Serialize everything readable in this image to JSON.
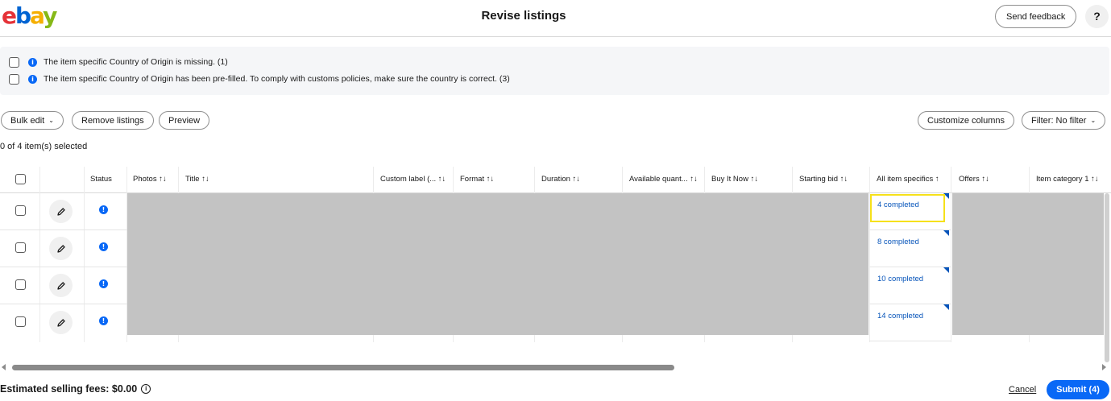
{
  "header": {
    "logo_letters": [
      "e",
      "b",
      "a",
      "y"
    ],
    "title": "Revise listings",
    "feedback_label": "Send feedback",
    "help_label": "?"
  },
  "notices": [
    {
      "text": "The item specific Country of Origin is missing. (1)",
      "icon": "info-icon"
    },
    {
      "text": "The item specific Country of Origin has been pre-filled. To comply with customs policies, make sure the country is correct. (3)",
      "icon": "info-icon"
    }
  ],
  "toolbar": {
    "bulk_edit": "Bulk edit",
    "remove_listings": "Remove listings",
    "preview": "Preview",
    "customize_columns": "Customize columns",
    "filter": "Filter: No filter"
  },
  "selection_text": "0 of 4 item(s) selected",
  "columns": {
    "status": "Status",
    "photos": "Photos ↑↓",
    "title": "Title ↑↓",
    "custom_label": "Custom label (... ↑↓",
    "format": "Format ↑↓",
    "duration": "Duration ↑↓",
    "available_quantity": "Available quant... ↑↓",
    "buy_it_now": "Buy It Now ↑↓",
    "starting_bid": "Starting bid ↑↓",
    "all_item_specifics": "All item specifics ↑",
    "offers": "Offers ↑↓",
    "item_category": "Item category 1 ↑↓"
  },
  "rows": [
    {
      "item_specifics": "4 completed"
    },
    {
      "item_specifics": "8 completed"
    },
    {
      "item_specifics": "10 completed"
    },
    {
      "item_specifics": "14 completed"
    }
  ],
  "icons": {
    "edit": "pencil-icon",
    "status": "info-icon",
    "fees_info": "info-icon"
  },
  "colors": {
    "ebay_red": "#e53238",
    "ebay_blue": "#0064d2",
    "ebay_yellow": "#f5af02",
    "ebay_green": "#86b817",
    "primary": "#0968f6",
    "link": "#0654ba",
    "highlight": "#f6e11a"
  },
  "footer": {
    "fees": "Estimated selling fees: $0.00",
    "fees_info_glyph": "i",
    "cancel": "Cancel",
    "submit": "Submit (4)"
  }
}
